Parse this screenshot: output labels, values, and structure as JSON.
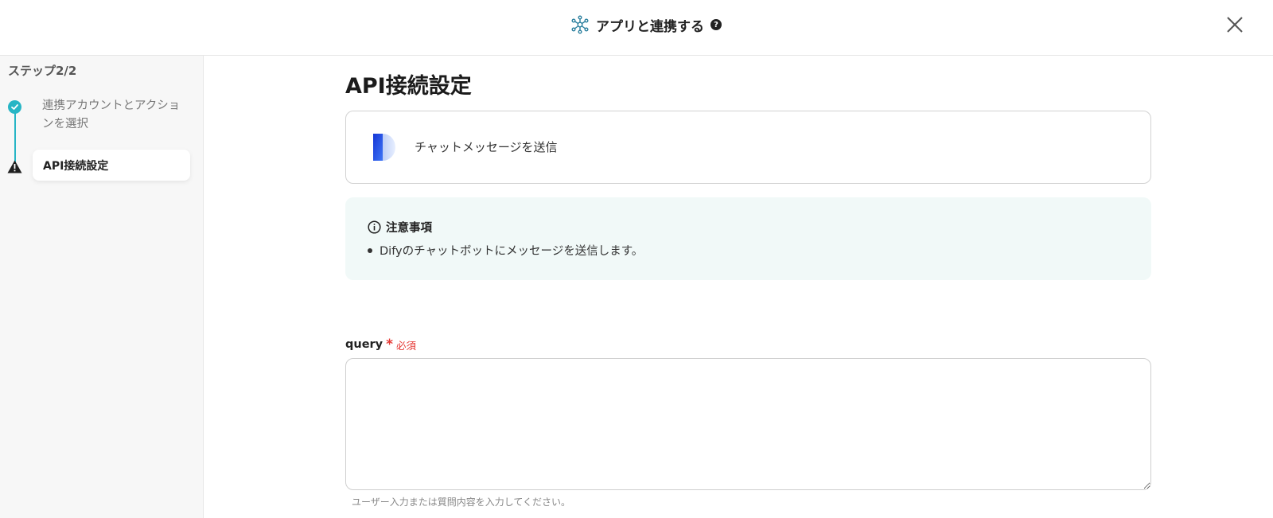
{
  "header": {
    "title": "アプリと連携する",
    "help_glyph": "?",
    "icon": "network-hub-icon"
  },
  "sidebar": {
    "step_count": "ステップ2/2",
    "steps": [
      {
        "label": "連携アカウントとアクションを選択",
        "status": "completed"
      },
      {
        "label": "API接続設定",
        "status": "warning"
      }
    ]
  },
  "main": {
    "title": "API接続設定",
    "action": {
      "label": "チャットメッセージを送信",
      "icon": "dify-logo-icon"
    },
    "notice": {
      "heading": "注意事項",
      "items": [
        "Difyのチャットボットにメッセージを送信します。"
      ]
    },
    "field": {
      "label": "query",
      "required_star": "*",
      "required_text": "必須",
      "value": "",
      "placeholder": "",
      "help": "ユーザー入力または質問内容を入力してください。"
    }
  },
  "colors": {
    "accent": "#27b5c5",
    "required": "#e53935",
    "notice_bg": "#f1f9f8"
  }
}
